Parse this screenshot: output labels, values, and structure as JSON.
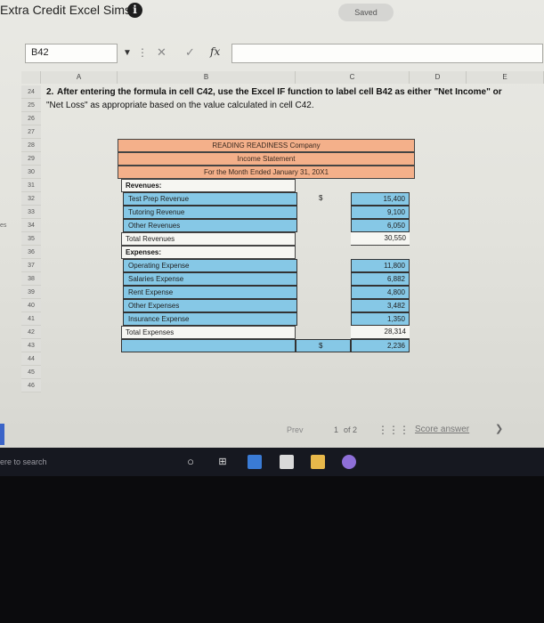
{
  "app": {
    "title": "Extra Credit Excel Sims",
    "status_button": "Saved"
  },
  "formula_bar": {
    "name_box": "B42",
    "cancel": "✕",
    "enter": "✓",
    "fx": "fx",
    "formula": ""
  },
  "columns": [
    "A",
    "B",
    "C",
    "D",
    "E"
  ],
  "rows": [
    "24",
    "25",
    "26",
    "27",
    "28",
    "29",
    "30",
    "31",
    "32",
    "33",
    "34",
    "35",
    "36",
    "37",
    "38",
    "39",
    "40",
    "41",
    "42",
    "43",
    "44",
    "45",
    "46"
  ],
  "instructions": {
    "line1_prefix": "2.",
    "line1": "After entering the formula in cell C42, use the Excel IF function to label cell B42 as either \"Net Income\" or",
    "line2": "\"Net Loss\" as appropriate based on the value calculated in cell C42."
  },
  "statement": {
    "company": "READING READINESS Company",
    "title": "Income Statement",
    "period": "For the Month Ended January 31, 20X1",
    "revenues_label": "Revenues:",
    "revenues": [
      {
        "name": "Test Prep Revenue",
        "value": "15,400",
        "dollar": "$"
      },
      {
        "name": "Tutoring Revenue",
        "value": "9,100"
      },
      {
        "name": "Other Revenues",
        "value": "6,050"
      }
    ],
    "total_revenues": {
      "name": "Total Revenues",
      "value": "30,550"
    },
    "expenses_label": "Expenses:",
    "expenses": [
      {
        "name": "Operating Expense",
        "value": "11,800"
      },
      {
        "name": "Salaries Expense",
        "value": "6,882"
      },
      {
        "name": "Rent Expense",
        "value": "4,800"
      },
      {
        "name": "Other Expenses",
        "value": "3,482"
      },
      {
        "name": "Insurance Expense",
        "value": "1,350"
      }
    ],
    "total_expenses": {
      "name": "Total Expenses",
      "value": "28,314"
    },
    "net": {
      "dollar": "$",
      "value": "2,236"
    }
  },
  "side_label": "es",
  "pagination": {
    "prev": "Prev",
    "current": "1",
    "of": "of 2",
    "score_answer": "Score answer",
    "next_icon": "chevron-right"
  },
  "taskbar": {
    "search": "ere to search"
  }
}
